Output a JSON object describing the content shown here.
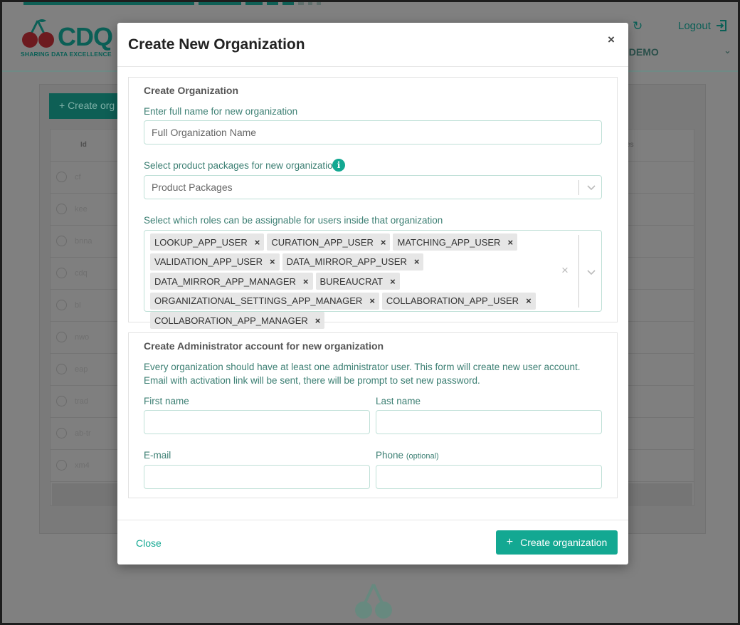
{
  "background": {
    "logo": {
      "word": "CDQ",
      "tagline": "SHARING DATA EXCELLENCE"
    },
    "logout_label": "Logout",
    "demo_label": "Q DEMO",
    "create_button": "+ Create org",
    "table_header_id": "Id",
    "table_header_right": "es",
    "rows": [
      "cf",
      "kee",
      "bnna",
      "cdq",
      "bl",
      "nwo",
      "eap",
      "trad",
      "ab-tr",
      "xm4"
    ]
  },
  "modal": {
    "title": "Create New Organization",
    "close_symbol": "×",
    "org_section": {
      "title": "Create Organization",
      "name_label": "Enter full name for new organization",
      "name_placeholder": "Full Organization Name",
      "packages_label": "Select product packages for new organization",
      "info_symbol": "i",
      "packages_placeholder": "Product Packages",
      "roles_label": "Select which roles can be assignable for users inside that organization",
      "clear_symbol": "×",
      "remove_symbol": "×",
      "roles": [
        "LOOKUP_APP_USER",
        "CURATION_APP_USER",
        "MATCHING_APP_USER",
        "VALIDATION_APP_USER",
        "DATA_MIRROR_APP_USER",
        "DATA_MIRROR_APP_MANAGER",
        "BUREAUCRAT",
        "ORGANIZATIONAL_SETTINGS_APP_MANAGER",
        "COLLABORATION_APP_USER",
        "COLLABORATION_APP_MANAGER"
      ]
    },
    "admin_section": {
      "title": "Create Administrator account for new organization",
      "description": "Every organization should have at least one administrator user. This form will create new user account. Email with activation link will be sent, there will be prompt to set new password.",
      "first_name_label": "First name",
      "last_name_label": "Last name",
      "email_label": "E-mail",
      "phone_label": "Phone",
      "phone_optional": "(optional)",
      "first_name_value": "",
      "last_name_value": "",
      "email_value": "",
      "phone_value": ""
    },
    "footer": {
      "close_label": "Close",
      "create_plus": "+",
      "create_label": "Create organization"
    }
  },
  "colors": {
    "accent": "#13a892",
    "label": "#3c7f73",
    "input_border": "#bfe0d7",
    "brand_dark": "#0b5f56"
  }
}
